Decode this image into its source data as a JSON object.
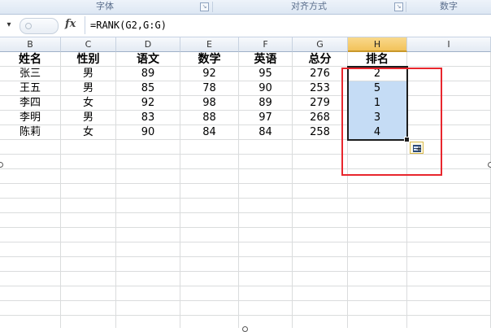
{
  "ribbon": {
    "groups": [
      "字体",
      "对齐方式",
      "数字"
    ]
  },
  "formula_bar": {
    "fx_label": "fx",
    "namebox_arrow": "▾",
    "formula": "=RANK(G2,G:G)"
  },
  "columns": [
    "B",
    "C",
    "D",
    "E",
    "F",
    "G",
    "H",
    "I"
  ],
  "selected_column": "H",
  "table": {
    "headers": [
      "姓名",
      "性别",
      "语文",
      "数学",
      "英语",
      "总分",
      "排名"
    ],
    "rows": [
      [
        "张三",
        "男",
        "89",
        "92",
        "95",
        "276",
        "2"
      ],
      [
        "王五",
        "男",
        "85",
        "78",
        "90",
        "253",
        "5"
      ],
      [
        "李四",
        "女",
        "92",
        "98",
        "89",
        "279",
        "1"
      ],
      [
        "李明",
        "男",
        "83",
        "88",
        "97",
        "268",
        "3"
      ],
      [
        "陈莉",
        "女",
        "90",
        "84",
        "84",
        "258",
        "4"
      ]
    ]
  },
  "colors": {
    "selection_fill": "#c5dcf5",
    "highlight_box": "#e8262d",
    "selected_header": "#f2c25a"
  },
  "icons": [
    "dialog-launcher-icon",
    "fx-icon",
    "autofill-options-icon"
  ]
}
